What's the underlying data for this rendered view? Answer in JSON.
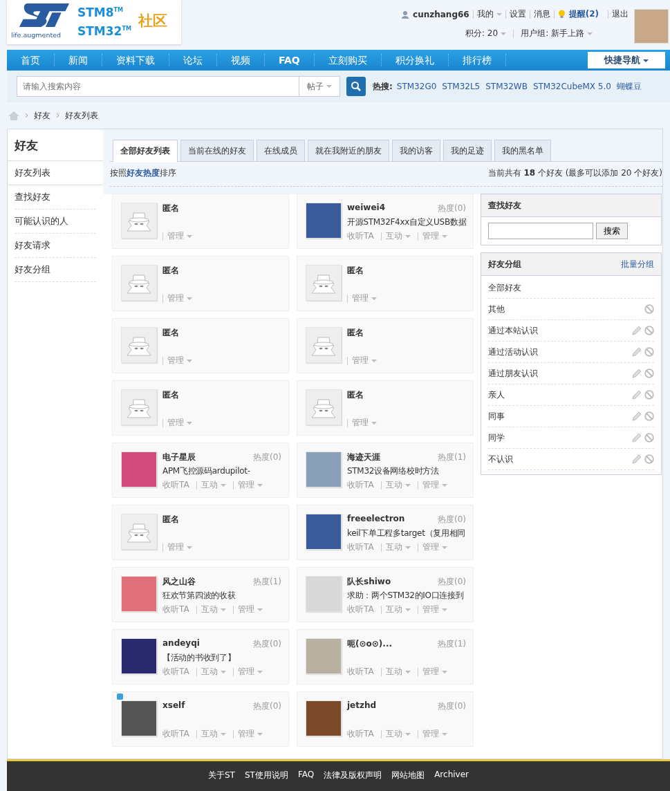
{
  "header": {
    "logo": {
      "stm8": "STM8",
      "tm8": "TM",
      "stm32": "STM32",
      "tm32": "TM",
      "community": "社区",
      "tagline": "life.augmented"
    },
    "user": {
      "name": "cunzhang66",
      "links": [
        {
          "label": "我的",
          "dropdown": true
        },
        {
          "label": "设置",
          "dropdown": false
        },
        {
          "label": "消息",
          "dropdown": false
        }
      ],
      "alert": "提醒(2)",
      "logout": "退出",
      "points": "积分: 20",
      "group": "用户组: 新手上路"
    }
  },
  "nav": {
    "items": [
      {
        "label": "首页",
        "bold": false
      },
      {
        "label": "新闻",
        "bold": false
      },
      {
        "label": "资料下载",
        "bold": false
      },
      {
        "label": "论坛",
        "bold": false
      },
      {
        "label": "视频",
        "bold": false
      },
      {
        "label": "FAQ",
        "bold": true
      },
      {
        "label": "立刻购买",
        "bold": false
      },
      {
        "label": "积分换礼",
        "bold": false
      },
      {
        "label": "排行榜",
        "bold": false
      }
    ],
    "quick": "快捷导航"
  },
  "search": {
    "placeholder": "请输入搜索内容",
    "scope": "帖子",
    "hot_label": "热搜:",
    "hot": [
      "STM32G0",
      "STM32L5",
      "STM32WB",
      "STM32CubeMX 5.0",
      "蝴蝶豆"
    ]
  },
  "breadcrumb": [
    "好友",
    "好友列表"
  ],
  "sidebar": {
    "title": "好友",
    "items": [
      {
        "label": "好友列表",
        "selected": true
      },
      {
        "label": "查找好友",
        "selected": false
      },
      {
        "label": "可能认识的人",
        "selected": false
      },
      {
        "label": "好友请求",
        "selected": false
      },
      {
        "label": "好友分组",
        "selected": false
      }
    ]
  },
  "tabs": [
    {
      "label": "全部好友列表",
      "selected": true
    },
    {
      "label": "当前在线的好友",
      "selected": false
    },
    {
      "label": "在线成员",
      "selected": false
    },
    {
      "label": "就在我附近的朋友",
      "selected": false
    },
    {
      "label": "我的访客",
      "selected": false
    },
    {
      "label": "我的足迹",
      "selected": false
    },
    {
      "label": "我的黑名单",
      "selected": false
    }
  ],
  "sort_note": "按照**好友热度**排序",
  "count_note": "当前共有 **18** 个好友 (最多可以添加 20 个好友)",
  "friends": [
    {
      "kind": "anonymous",
      "name": "匿名",
      "badge": false,
      "actions": [
        {
          "label": "管理",
          "dropdown": true
        }
      ]
    },
    {
      "kind": "member",
      "name": "weiwei4",
      "heat": "热度(0)",
      "post": "开源STM32F4xx自定义USB数据",
      "badge": false,
      "actions": [
        {
          "label": "收听TA",
          "dropdown": false
        },
        {
          "label": "互动",
          "dropdown": true
        },
        {
          "label": "管理",
          "dropdown": true
        }
      ]
    },
    {
      "kind": "anonymous",
      "name": "匿名",
      "badge": false,
      "actions": [
        {
          "label": "管理",
          "dropdown": true
        }
      ]
    },
    {
      "kind": "anonymous",
      "name": "匿名",
      "badge": false,
      "actions": [
        {
          "label": "管理",
          "dropdown": true
        }
      ]
    },
    {
      "kind": "anonymous",
      "name": "匿名",
      "badge": false,
      "actions": [
        {
          "label": "管理",
          "dropdown": true
        }
      ]
    },
    {
      "kind": "anonymous",
      "name": "匿名",
      "badge": false,
      "actions": [
        {
          "label": "管理",
          "dropdown": true
        }
      ]
    },
    {
      "kind": "anonymous",
      "name": "匿名",
      "badge": false,
      "actions": [
        {
          "label": "管理",
          "dropdown": true
        }
      ]
    },
    {
      "kind": "anonymous",
      "name": "匿名",
      "badge": false,
      "actions": [
        {
          "label": "管理",
          "dropdown": true
        }
      ]
    },
    {
      "kind": "member",
      "name": "电子星辰",
      "heat": "热度(0)",
      "post": "APM飞控源码ardupilot-",
      "badge": false,
      "actions": [
        {
          "label": "收听TA",
          "dropdown": false
        },
        {
          "label": "互动",
          "dropdown": true
        },
        {
          "label": "管理",
          "dropdown": true
        }
      ]
    },
    {
      "kind": "member",
      "name": "海迹天涯",
      "heat": "热度(1)",
      "post": "STM32设备网络校时方法",
      "badge": false,
      "actions": [
        {
          "label": "收听TA",
          "dropdown": false
        },
        {
          "label": "互动",
          "dropdown": true
        },
        {
          "label": "管理",
          "dropdown": true
        }
      ]
    },
    {
      "kind": "anonymous",
      "name": "匿名",
      "badge": false,
      "actions": [
        {
          "label": "管理",
          "dropdown": true
        }
      ]
    },
    {
      "kind": "member",
      "name": "freeelectron",
      "heat": "热度(0)",
      "post": "keil下单工程多target（复用相同",
      "badge": false,
      "actions": [
        {
          "label": "收听TA",
          "dropdown": false
        },
        {
          "label": "互动",
          "dropdown": true
        },
        {
          "label": "管理",
          "dropdown": true
        }
      ]
    },
    {
      "kind": "member",
      "name": "风之山谷",
      "heat": "热度(1)",
      "post": "狂欢节第四波的收获",
      "badge": false,
      "actions": [
        {
          "label": "收听TA",
          "dropdown": false
        },
        {
          "label": "互动",
          "dropdown": true
        },
        {
          "label": "管理",
          "dropdown": true
        }
      ]
    },
    {
      "kind": "member",
      "name": "队长shiwo",
      "heat": "热度(0)",
      "post": "求助：两个STM32的IO口连接到",
      "badge": false,
      "actions": [
        {
          "label": "收听TA",
          "dropdown": false
        },
        {
          "label": "互动",
          "dropdown": true
        },
        {
          "label": "管理",
          "dropdown": true
        }
      ]
    },
    {
      "kind": "member",
      "name": "andeyqi",
      "heat": "热度(0)",
      "post": "【活动的书收到了】",
      "badge": false,
      "actions": [
        {
          "label": "收听TA",
          "dropdown": false
        },
        {
          "label": "互动",
          "dropdown": true
        },
        {
          "label": "管理",
          "dropdown": true
        }
      ]
    },
    {
      "kind": "member",
      "name": "呃(⊙o⊙)...",
      "heat": "热度(1)",
      "badge": false,
      "actions": [
        {
          "label": "收听TA",
          "dropdown": false
        },
        {
          "label": "互动",
          "dropdown": true
        },
        {
          "label": "管理",
          "dropdown": true
        }
      ]
    },
    {
      "kind": "member",
      "name": "xself",
      "heat": "热度(0)",
      "badge": true,
      "actions": [
        {
          "label": "收听TA",
          "dropdown": false
        },
        {
          "label": "互动",
          "dropdown": true
        },
        {
          "label": "管理",
          "dropdown": true
        }
      ]
    },
    {
      "kind": "member",
      "name": "jetzhd",
      "heat": "热度(0)",
      "badge": false,
      "actions": [
        {
          "label": "收听TA",
          "dropdown": false
        },
        {
          "label": "互动",
          "dropdown": true
        },
        {
          "label": "管理",
          "dropdown": true
        }
      ]
    }
  ],
  "find_panel": {
    "title": "查找好友",
    "button": "搜索"
  },
  "groups_panel": {
    "title": "好友分组",
    "action": "批量分组",
    "groups": [
      {
        "label": "全部好友",
        "editable": false,
        "deletable": false
      },
      {
        "label": "其他",
        "editable": false,
        "deletable": true
      },
      {
        "label": "通过本站认识",
        "editable": true,
        "deletable": true
      },
      {
        "label": "通过活动认识",
        "editable": true,
        "deletable": true
      },
      {
        "label": "通过朋友认识",
        "editable": true,
        "deletable": true
      },
      {
        "label": "亲人",
        "editable": true,
        "deletable": true
      },
      {
        "label": "同事",
        "editable": true,
        "deletable": true
      },
      {
        "label": "同学",
        "editable": true,
        "deletable": true
      },
      {
        "label": "不认识",
        "editable": true,
        "deletable": true
      }
    ]
  },
  "footer": {
    "links": [
      "关于ST",
      "ST使用说明",
      "FAQ",
      "法律及版权声明",
      "网站地图",
      "Archiver"
    ]
  }
}
